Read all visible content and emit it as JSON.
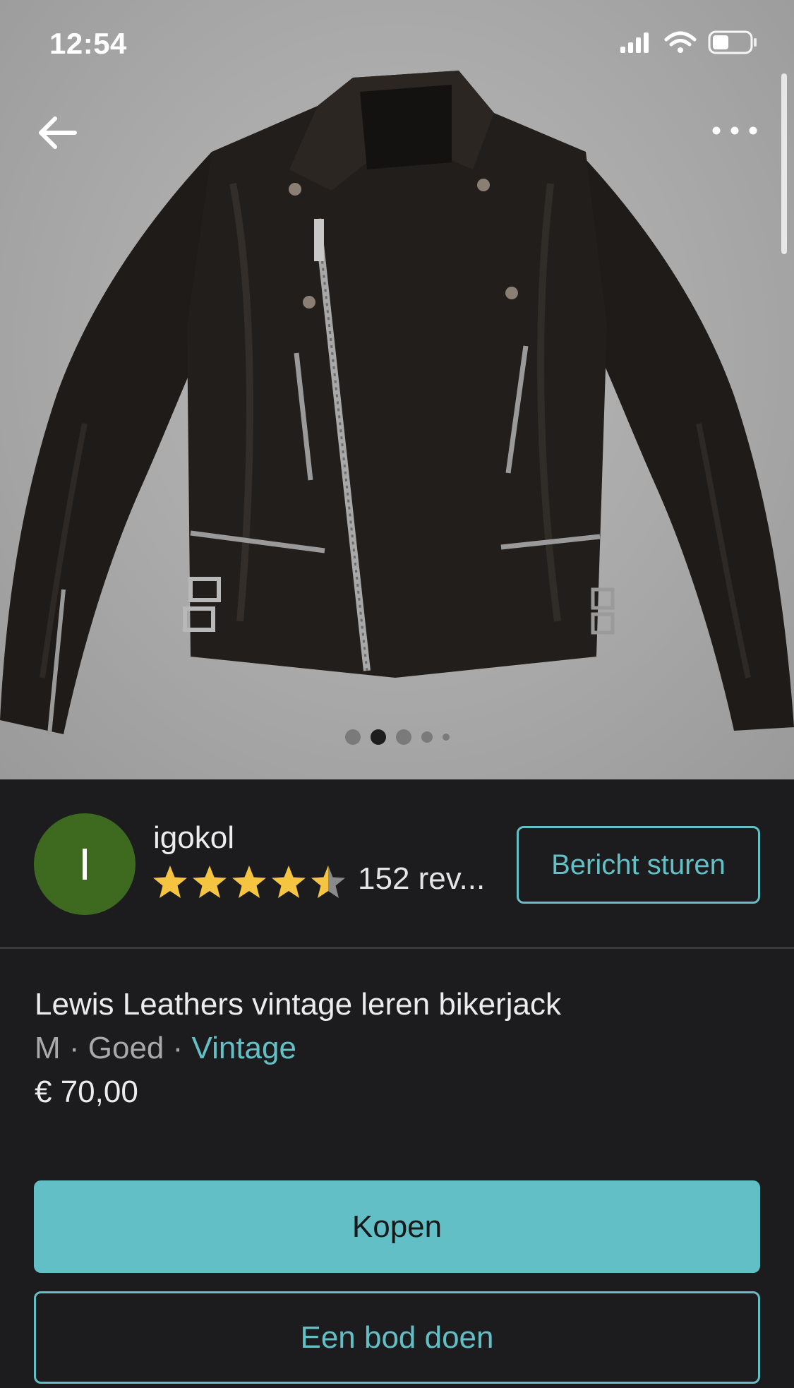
{
  "status_bar": {
    "time": "12:54"
  },
  "gallery": {
    "image_count": 5,
    "active_index": 1
  },
  "icons": {
    "back": "arrow-left-icon",
    "more": "more-horizontal-icon",
    "signal": "cellular-signal-icon",
    "wifi": "wifi-icon",
    "battery": "battery-icon",
    "star": "star-icon"
  },
  "seller": {
    "avatar_initial": "I",
    "avatar_color": "#3d6a1f",
    "name": "igokol",
    "rating": 4.5,
    "rating_max": 5,
    "reviews_label": "152 rev...",
    "message_button": "Bericht sturen"
  },
  "item": {
    "title": "Lewis Leathers vintage leren bikerjack",
    "size": "M",
    "separator": " · ",
    "condition": "Goed",
    "brand_link": "Vintage",
    "price": "€ 70,00"
  },
  "actions": {
    "buy": "Kopen",
    "offer": "Een bod doen"
  },
  "colors": {
    "accent": "#62bfc5",
    "background": "#1c1c1e",
    "star": "#f5c542"
  }
}
